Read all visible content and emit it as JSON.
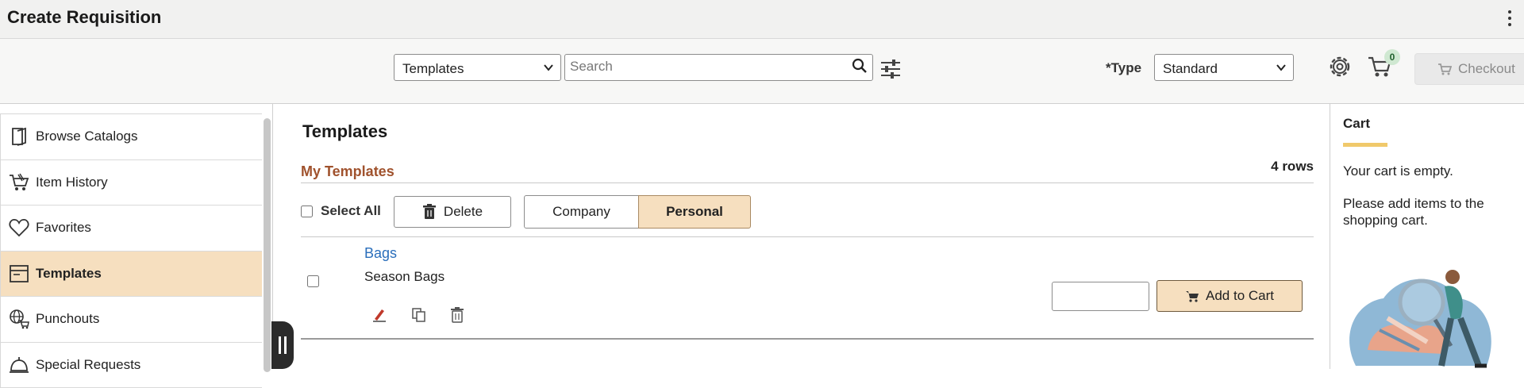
{
  "header": {
    "title": "Create Requisition"
  },
  "toolbar": {
    "search_scope": "Templates",
    "search_placeholder": "Search",
    "type_label": "*Type",
    "type_value": "Standard",
    "cart_count": "0",
    "checkout_label": "Checkout"
  },
  "sidebar": {
    "items": [
      {
        "label": "Browse Catalogs",
        "icon": "book-icon"
      },
      {
        "label": "Item History",
        "icon": "cart-history-icon"
      },
      {
        "label": "Favorites",
        "icon": "heart-icon"
      },
      {
        "label": "Templates",
        "icon": "template-icon",
        "active": true
      },
      {
        "label": "Punchouts",
        "icon": "globe-cart-icon"
      },
      {
        "label": "Special Requests",
        "icon": "bell-icon"
      }
    ]
  },
  "main": {
    "title": "Templates",
    "grid_title": "My Templates",
    "row_count": "4 rows",
    "select_all_label": "Select All",
    "delete_label": "Delete",
    "segments": [
      "Company",
      "Personal"
    ],
    "selected_segment": "Personal",
    "rows": [
      {
        "name": "Bags",
        "description": "Season Bags",
        "quantity": ""
      }
    ],
    "add_to_cart_label": "Add to Cart"
  },
  "cart_panel": {
    "title": "Cart",
    "empty_text": "Your cart is empty.",
    "message": "Please add items to the shopping cart."
  },
  "colors": {
    "accent_active": "#f6dfbf",
    "grid_title": "#a0522d",
    "link": "#2a6ebb",
    "cart_underline": "#f0c96b"
  }
}
